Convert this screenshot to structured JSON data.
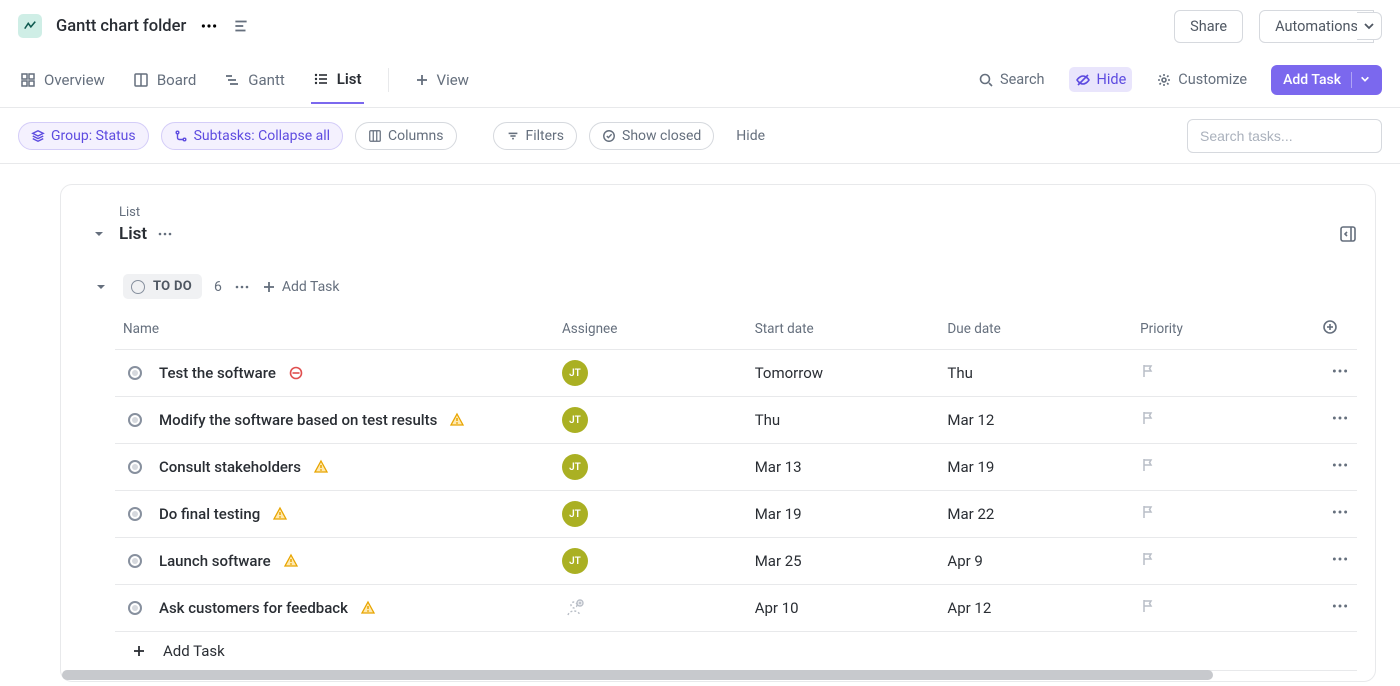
{
  "colors": {
    "accent": "#7b68ee",
    "avatar": "#aab023"
  },
  "header": {
    "title": "Gantt chart folder",
    "share": "Share",
    "automations": "Automations"
  },
  "viewtabs": {
    "overview": "Overview",
    "board": "Board",
    "gantt": "Gantt",
    "list": "List",
    "add_view": "View"
  },
  "tools": {
    "search": "Search",
    "hide": "Hide",
    "customize": "Customize",
    "add_task": "Add Task"
  },
  "filters": {
    "group": "Group: Status",
    "subtasks": "Subtasks: Collapse all",
    "columns": "Columns",
    "filters": "Filters",
    "show_closed": "Show closed",
    "hide": "Hide",
    "search_placeholder": "Search tasks..."
  },
  "list": {
    "crumb": "List",
    "title": "List",
    "group": {
      "status_label": "TO DO",
      "count": "6",
      "add_task": "Add Task"
    },
    "columns": {
      "name": "Name",
      "assignee": "Assignee",
      "start": "Start date",
      "due": "Due date",
      "priority": "Priority"
    },
    "tasks": [
      {
        "name": "Test the software",
        "badge": "block",
        "assignee": "JT",
        "start": "Tomorrow",
        "due": "Thu"
      },
      {
        "name": "Modify the software based on test results",
        "badge": "warn",
        "assignee": "JT",
        "start": "Thu",
        "due": "Mar 12"
      },
      {
        "name": "Consult stakeholders",
        "badge": "warn",
        "assignee": "JT",
        "start": "Mar 13",
        "due": "Mar 19"
      },
      {
        "name": "Do final testing",
        "badge": "warn",
        "assignee": "JT",
        "start": "Mar 19",
        "due": "Mar 22"
      },
      {
        "name": "Launch software",
        "badge": "warn",
        "assignee": "JT",
        "start": "Mar 25",
        "due": "Apr 9"
      },
      {
        "name": "Ask customers for feedback",
        "badge": "warn",
        "assignee": "",
        "start": "Apr 10",
        "due": "Apr 12"
      }
    ],
    "add_task_row": "Add Task"
  }
}
